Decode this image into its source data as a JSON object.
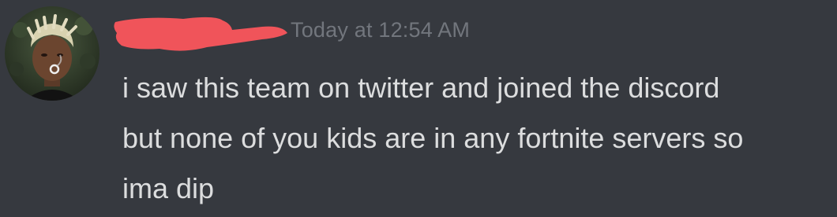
{
  "message": {
    "author": {
      "name": "",
      "avatar_icon": "user-avatar-icon",
      "name_redaction_color": "#f0545a"
    },
    "timestamp": "Today at 12:54 AM",
    "lines": [
      "i saw this team on twitter and joined the discord",
      "but none of you kids are in any fortnite servers so",
      "ima dip"
    ]
  },
  "colors": {
    "background": "#36393f",
    "text": "#dcddde",
    "timestamp": "#72767d"
  }
}
